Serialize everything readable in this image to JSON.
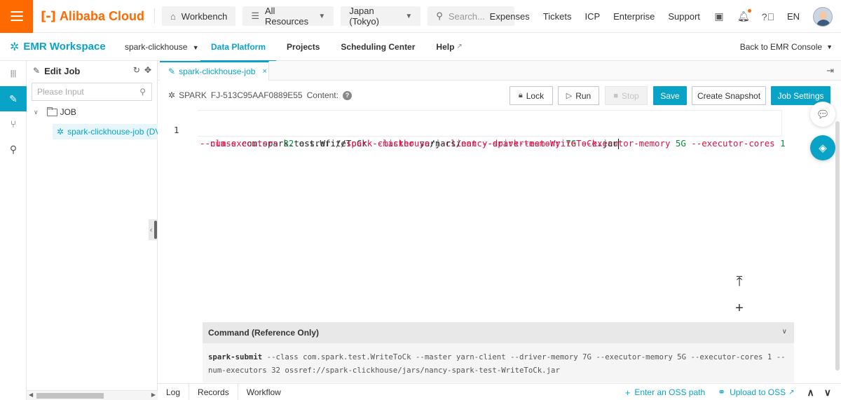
{
  "topbar": {
    "logo_text": "Alibaba Cloud",
    "workbench": "Workbench",
    "all_resources": "All Resources",
    "region": "Japan (Tokyo)",
    "search_placeholder": "Search...",
    "links": [
      "Expenses",
      "Tickets",
      "ICP",
      "Enterprise",
      "Support"
    ],
    "language": "EN",
    "accent_color": "#ff6a00"
  },
  "subbar": {
    "brand": "EMR Workspace",
    "workspace": "spark-clickhouse",
    "tabs": [
      "Data Platform",
      "Projects",
      "Scheduling Center",
      "Help"
    ],
    "active_tab": "Data Platform",
    "back": "Back to EMR Console",
    "brand_color": "#0aa3c8"
  },
  "tree": {
    "title": "Edit Job",
    "search_placeholder": "Please Input",
    "folder": "JOB",
    "job": "spark-clickhouse-job (DV"
  },
  "editor": {
    "tab_label": "spark-clickhouse-job",
    "job_type": "SPARK",
    "job_id": "FJ-513C95AAF0889E55",
    "content_label": "Content:",
    "buttons": {
      "lock": "Lock",
      "run": "Run",
      "stop": "Stop",
      "save": "Save",
      "snapshot": "Create Snapshot",
      "settings": "Job Settings"
    },
    "line_number": "1",
    "code_line1": {
      "p1": "--class",
      "p2": " com.spark.test.WriteToCk ",
      "p3": "--master",
      "p4": " yarn",
      "p5": "-client",
      "p6": " --driver-memory",
      "p7": " 7G",
      "p8": " --executor-memory",
      "p9": " 5G",
      "p10": " --executor-cores",
      "p11": " 1"
    },
    "code_line2": {
      "p1": "--num-executors",
      "p2": " 32",
      "p3": " ossref://",
      "p4": "spark-clickhouse",
      "p5": "/jars/",
      "p6": "nancy-spark-test-WriteToCk",
      "p7": ".jar"
    },
    "command_panel": {
      "title": "Command (Reference Only)",
      "cmd_name": "spark-submit",
      "cmd_args": " --class com.spark.test.WriteToCk --master yarn-client --driver-memory 7G --executor-memory 5G --executor-cores 1 --num-executors 32 ossref://spark-clickhouse/jars/nancy-spark-test-WriteToCk.jar"
    },
    "bottom_tabs": [
      "Log",
      "Records",
      "Workflow"
    ],
    "enter_oss": "Enter an OSS path",
    "upload_oss": "Upload to OSS"
  }
}
